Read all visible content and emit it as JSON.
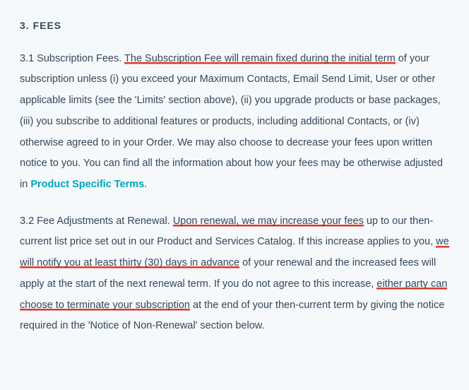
{
  "heading": "3.  FEES",
  "s31": {
    "lead": "3.1  Subscription Fees. ",
    "u1": "The Subscription Fee will remain fixed during the initial term",
    "t2": " of your subscription unless (i) you exceed your Maximum Contacts, Email Send Limit, User or other applicable limits (see the 'Limits' section above), (ii) you upgrade products or base packages, (iii) you subscribe to additional features or products, including additional Contacts, or (iv) otherwise agreed to in your Order. We may also choose to decrease your fees upon written notice to you. You can find all the information about how your fees may be otherwise adjusted in ",
    "link": "Product Specific Terms",
    "period": "."
  },
  "s32": {
    "lead": "3.2  Fee Adjustments at Renewal. ",
    "u1": "Upon renewal, we may increase your fees",
    "t2": " up to our then-current list price set out in our Product and Services Catalog. If this increase applies to you, ",
    "u2": "we will notify you at least thirty (30) days in advance",
    "t3": " of your renewal and the increased fees will apply at the start of the next renewal term. If you do not agree to this increase, ",
    "u3": "either party can choose to terminate your subscription",
    "t4": " at the end of your then-current term by giving the notice required in the 'Notice of Non-Renewal' section below."
  }
}
